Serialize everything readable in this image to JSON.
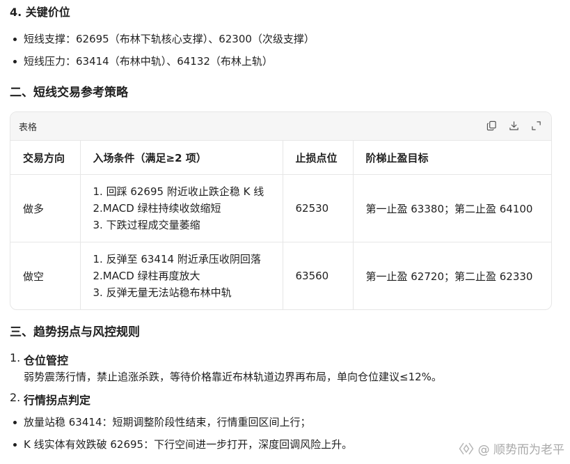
{
  "key_levels": {
    "heading": "4. 关键价位",
    "items": [
      "短线支撑：62695（布林下轨核心支撑）、62300（次级支撑）",
      "短线压力：63414（布林中轨）、64132（布林上轨）"
    ]
  },
  "section2": {
    "heading": "二、短线交易参考策略"
  },
  "table_card": {
    "title": "表格",
    "icons": [
      "copy-icon",
      "download-icon",
      "expand-icon"
    ],
    "headers": [
      "交易方向",
      "入场条件（满足≥2 项）",
      "止损点位",
      "阶梯止盈目标"
    ],
    "rows": [
      {
        "direction": "做多",
        "conditions": [
          "1. 回踩 62695 附近收止跌企稳 K 线",
          "2.MACD 绿柱持续收敛缩短",
          "3. 下跌过程成交量萎缩"
        ],
        "stop_loss": "62530",
        "targets": "第一止盈 63380；第二止盈 64100"
      },
      {
        "direction": "做空",
        "conditions": [
          "1. 反弹至 63414 附近承压收阴回落",
          "2.MACD 绿柱再度放大",
          "3. 反弹无量无法站稳布林中轨"
        ],
        "stop_loss": "63560",
        "targets": "第一止盈 62720；第二止盈 62330"
      }
    ]
  },
  "section3": {
    "heading": "三、趋势拐点与风控规则",
    "items": [
      {
        "number": "1.",
        "title": "仓位管控",
        "desc": "弱势震荡行情，禁止追涨杀跌，等待价格靠近布林轨道边界再布局，单向仓位建议≤12%。"
      },
      {
        "number": "2.",
        "title": "行情拐点判定"
      }
    ],
    "bullets": [
      "放量站稳 63414：短期调整阶段性结束，行情重回区间上行；",
      "K 线实体有效跌破 62695：下行空间进一步打开，深度回调风险上升。"
    ]
  },
  "watermark": {
    "text": "@ 顺势而为老平"
  }
}
